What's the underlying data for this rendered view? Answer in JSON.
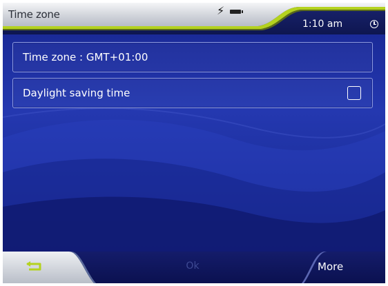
{
  "window": {
    "title": "Time zone",
    "time": "1:10 am"
  },
  "icons": {
    "power": "⚡",
    "battery": "battery-icon",
    "clock": "clock-icon",
    "back": "back-arrow-icon"
  },
  "settings": {
    "timezone_label": "Time zone : GMT+01:00",
    "daylight_label": "Daylight saving time",
    "daylight_checked": false
  },
  "footer": {
    "ok_label": "Ok",
    "more_label": "More"
  },
  "colors": {
    "accent_green": "#b4d21e",
    "background_blue": "#1c2e9c"
  }
}
